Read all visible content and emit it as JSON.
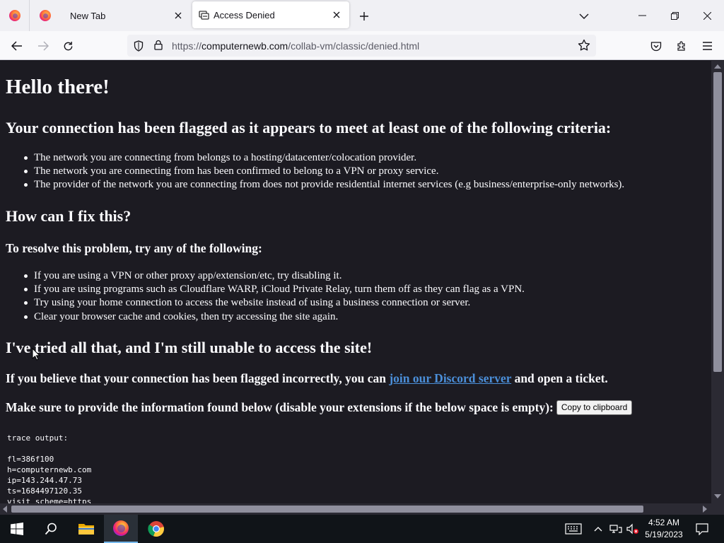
{
  "browser": {
    "tabs": [
      {
        "title": "New Tab"
      },
      {
        "title": "Access Denied"
      }
    ],
    "url": {
      "prefix": "https://",
      "host": "computernewb.com",
      "path": "/collab-vm/classic/denied.html"
    }
  },
  "page": {
    "heading": "Hello there!",
    "flagged_heading": "Your connection has been flagged as it appears to meet at least one of the following criteria:",
    "criteria": [
      "The network you are connecting from belongs to a hosting/datacenter/colocation provider.",
      "The network you are connecting from has been confirmed to belong to a VPN or proxy service.",
      "The provider of the network you are connecting from does not provide residential internet services (e.g business/enterprise-only networks)."
    ],
    "fix_heading": "How can I fix this?",
    "resolve_heading": "To resolve this problem, try any of the following:",
    "fixes": [
      "If you are using a VPN or other proxy app/extension/etc, try disabling it.",
      "If you are using programs such as Cloudflare WARP, iCloud Private Relay, turn them off as they can flag as a VPN.",
      "Try using your home connection to access the website instead of using a business connection or server.",
      "Clear your browser cache and cookies, then try accessing the site again."
    ],
    "still_heading": "I've tried all that, and I'm still unable to access the site!",
    "discord_prefix": "If you believe that your connection has been flagged incorrectly, you can ",
    "discord_link": "join our Discord server",
    "discord_suffix": " and open a ticket.",
    "info_text": "Make sure to provide the information found below (disable your extensions if the below space is empty):",
    "copy_button": "Copy to clipboard",
    "trace_title": "trace output:",
    "trace_lines": [
      "fl=386f100",
      "h=computernewb.com",
      "ip=143.244.47.73",
      "ts=1684497120.35",
      "visit_scheme=https"
    ]
  },
  "taskbar": {
    "time": "4:52 AM",
    "date": "5/19/2023"
  },
  "colors": {
    "page_background": "#1c1b22",
    "link": "#4b8fd9",
    "taskbar": "#101418"
  }
}
